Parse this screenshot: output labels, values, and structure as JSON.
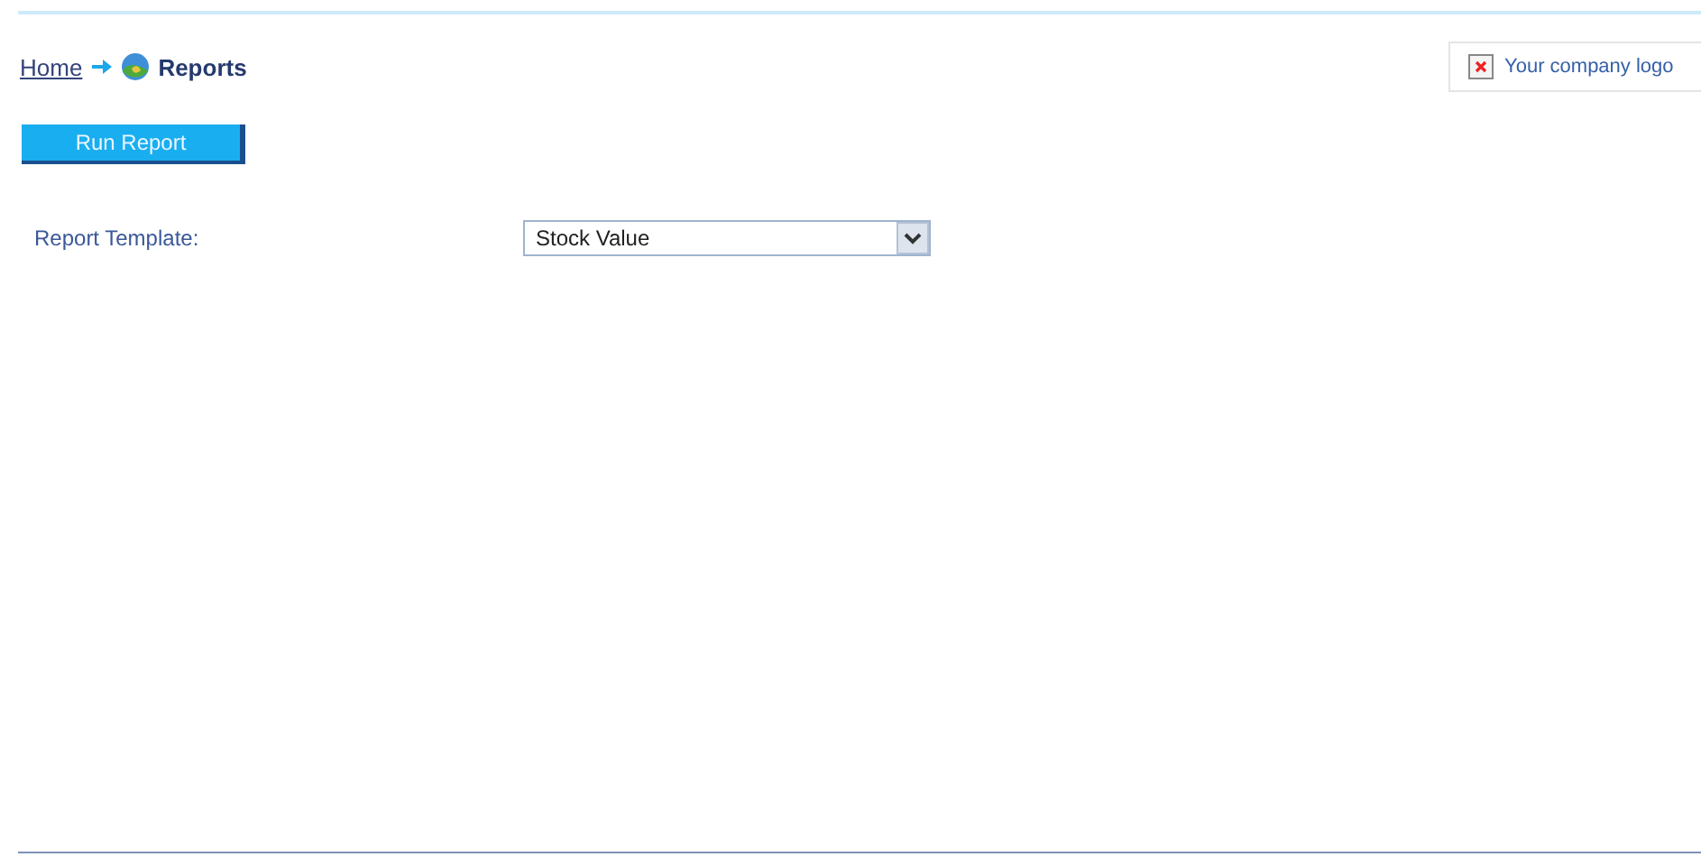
{
  "breadcrumb": [
    {
      "label": "Home",
      "kind": "link"
    },
    {
      "label": "Reports",
      "kind": "current"
    }
  ],
  "logo": {
    "label": "Your company logo"
  },
  "run_button": {
    "label": "Run Report"
  },
  "form": {
    "label": "Report Template:",
    "value": "Stock Value"
  }
}
